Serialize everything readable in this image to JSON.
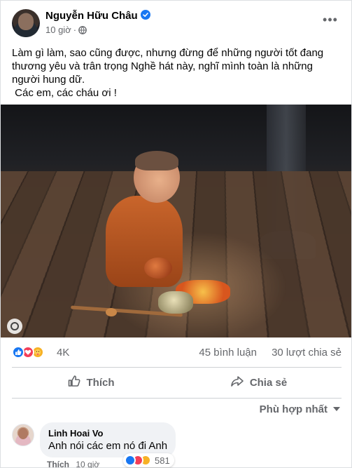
{
  "post": {
    "author": "Nguyễn Hữu Châu",
    "time": "10 giờ",
    "dot": "·",
    "text": "Làm gì làm, sao cũng được, nhưng đừng để những người tốt đang thương yêu và trân trọng Nghề hát này, nghĩ mình toàn là những người hung dữ.\n Các em, các cháu ơi !"
  },
  "stats": {
    "reactions": "4K",
    "comments": "45 bình luận",
    "shares": "30 lượt chia sẻ"
  },
  "actions": {
    "like": "Thích",
    "share": "Chia sẻ"
  },
  "sort": {
    "label": "Phù hợp nhất"
  },
  "comment": {
    "author": "Linh Hoai Vo",
    "text": "Anh nói các em nó đi Anh",
    "like": "Thích",
    "time": "10 giờ",
    "reactions": "581"
  },
  "icons": {
    "verified": "verified-badge-icon",
    "globe": "globe-icon",
    "more": "more-options-icon",
    "like_reaction": "like-reaction-icon",
    "love_reaction": "love-reaction-icon",
    "care_reaction": "care-reaction-icon",
    "like_action": "thumbs-up-icon",
    "share_action": "share-arrow-icon"
  },
  "colors": {
    "brand": "#1877f2",
    "love": "#f33e58",
    "care": "#f7b125",
    "secondary_text": "#65676b",
    "bubble": "#f0f2f5"
  }
}
